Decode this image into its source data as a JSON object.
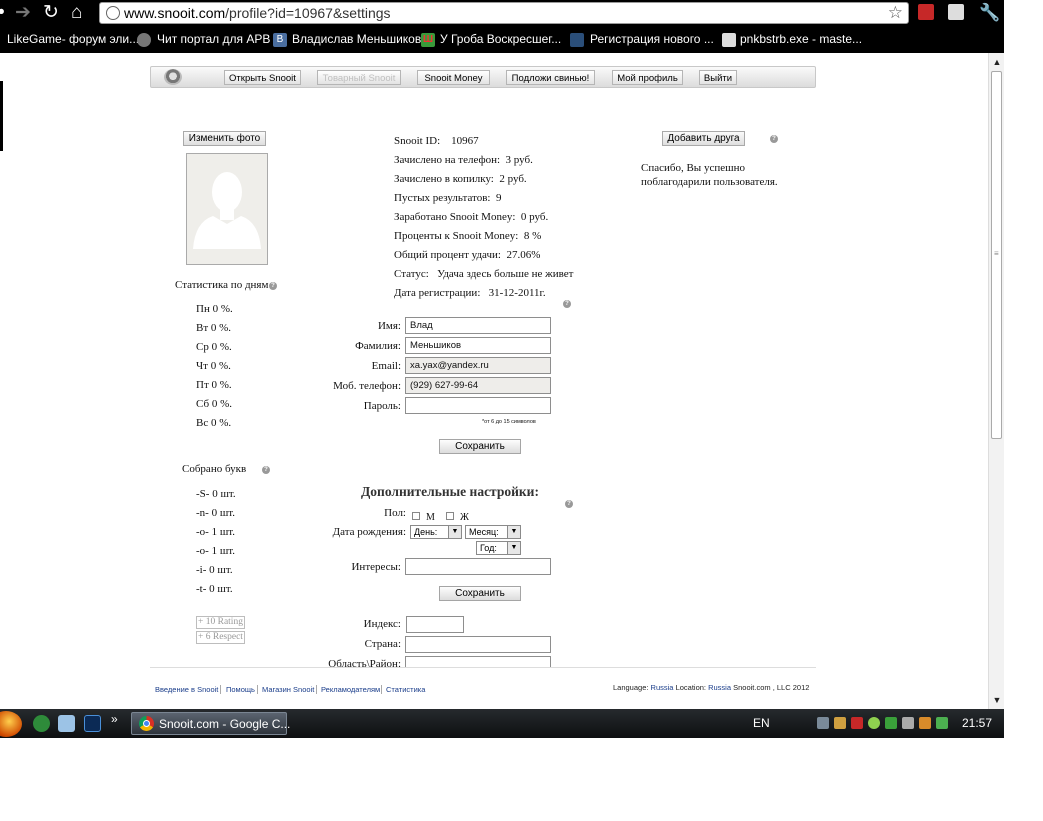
{
  "browser": {
    "url_host": "www.snooit.com",
    "url_path": "/profile?id=10967&settings",
    "bookmarks": [
      "LikeGame- форум эли...",
      "Чит портал для APB",
      "Владислав Меньшиков",
      "У Гроба Воскресшег...",
      "Регистрация нового ...",
      "pnkbstrb.exe - maste..."
    ],
    "bookmark_icon_letters": [
      "",
      "",
      "B",
      "Ш",
      "",
      ""
    ]
  },
  "site_nav": {
    "items": [
      "Открыть Snooit",
      "Товарный Snooit",
      "Snooit Money",
      "Подложи свинью!",
      "Мой профиль",
      "Выйти"
    ]
  },
  "left": {
    "change_photo": "Изменить фото",
    "stats_title": "Статистика по дням",
    "days": [
      "Пн 0 %.",
      "Вт 0 %.",
      "Ср 0 %.",
      "Чт 0 %.",
      "Пт 0 %.",
      "Сб 0 %.",
      "Вс 0 %."
    ],
    "letters_title": "Собрано букв",
    "letters": [
      "-S- 0 шт.",
      "-n- 0 шт.",
      "-o- 1 шт.",
      "-o- 1 шт.",
      "-i- 0 шт.",
      "-t- 0 шт."
    ],
    "rating": "+ 10 Rating",
    "respect": "+ 6 Respect"
  },
  "stats": [
    {
      "label": "Snooit ID:",
      "value": "10967"
    },
    {
      "label": "Зачислено на телефон:",
      "value": "3 руб."
    },
    {
      "label": "Зачислено в копилку:",
      "value": "2 руб."
    },
    {
      "label": "Пустых результатов:",
      "value": "9"
    },
    {
      "label": "Заработано Snooit Money:",
      "value": "0 руб."
    },
    {
      "label": "Проценты к Snooit Money:",
      "value": "8 %"
    },
    {
      "label": "Общий процент удачи:",
      "value": "27.06%"
    },
    {
      "label": "Статус:",
      "value": "Удача здесь больше не живет"
    },
    {
      "label": "Дата регистрации:",
      "value": "31-12-2011г."
    }
  ],
  "form": {
    "name_label": "Имя:",
    "name_value": "Влад",
    "surname_label": "Фамилия:",
    "surname_value": "Меньшиков",
    "email_label": "Email:",
    "email_value": "xa.yax@yandex.ru",
    "phone_label": "Моб. телефон:",
    "phone_value": "(929) 627-99-64",
    "password_label": "Пароль:",
    "password_value": "",
    "password_hint": "*от 6 до 15 символов",
    "save": "Сохранить"
  },
  "extra": {
    "title": "Дополнительные настройки:",
    "gender_label": "Пол:",
    "male": "М",
    "female": "Ж",
    "birth_label": "Дата рождения:",
    "day": "День:",
    "month": "Месяц:",
    "year": "Год:",
    "interests_label": "Интересы:",
    "interests_value": "",
    "save": "Сохранить",
    "index_label": "Индекс:",
    "country_label": "Страна:",
    "region_label": "Область\\Район:"
  },
  "right": {
    "add_friend": "Добавить друга",
    "thanks": "Спасибо, Вы успешно поблагодарили пользователя."
  },
  "footer": {
    "links": [
      "Введение в Snooit",
      "Помощь",
      "Магазин Snooit",
      "Рекламодателям",
      "Статистика"
    ],
    "language": "Language: ",
    "language_value": "Russia",
    "location": " Location: ",
    "location_value": "Russia",
    "copyright": " Snooit.com , LLC 2012"
  },
  "taskbar": {
    "task_title": "Snooit.com - Google C...",
    "lang": "EN",
    "time": "21:57"
  },
  "colors": {
    "link": "#1a3d8a",
    "chrome": "#000000",
    "accent_red": "#d93025"
  }
}
